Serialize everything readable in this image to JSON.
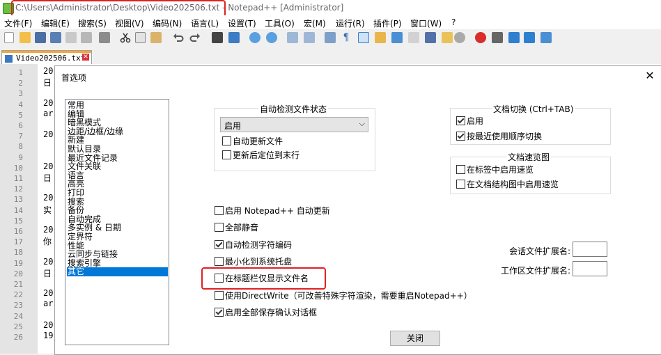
{
  "window": {
    "title": "C:\\Users\\Administrator\\Desktop\\Video202506.txt - Notepad++ [Administrator]"
  },
  "menu": [
    "文件(F)",
    "编辑(E)",
    "搜索(S)",
    "视图(V)",
    "编码(N)",
    "语言(L)",
    "设置(T)",
    "工具(O)",
    "宏(M)",
    "运行(R)",
    "插件(P)",
    "窗口(W)",
    "?"
  ],
  "tab": {
    "label": "Video202506.txt",
    "close_glyph": "✕"
  },
  "editor": {
    "line_numbers": [
      "1",
      "2",
      "3",
      "4",
      "5",
      "6",
      "7",
      "8",
      "9",
      "10",
      "11",
      "12",
      "13",
      "14",
      "15",
      "16",
      "17",
      "18",
      "19",
      "20",
      "21",
      "22",
      "23",
      "24",
      "25",
      "26"
    ],
    "code_lines": [
      {
        "line": 1,
        "text": "20"
      },
      {
        "line": 2,
        "text": "日"
      },
      {
        "line": 4,
        "text": "20"
      },
      {
        "line": 5,
        "text": "ar"
      },
      {
        "line": 7,
        "text": "20"
      },
      {
        "line": 10,
        "text": "20"
      },
      {
        "line": 11,
        "text": "日"
      },
      {
        "line": 13,
        "text": "20"
      },
      {
        "line": 14,
        "text": "实"
      },
      {
        "line": 16,
        "text": "20"
      },
      {
        "line": 17,
        "text": "你"
      },
      {
        "line": 19,
        "text": "20"
      },
      {
        "line": 20,
        "text": "日"
      },
      {
        "line": 22,
        "text": "20"
      },
      {
        "line": 23,
        "text": "ar"
      },
      {
        "line": 25,
        "text": "20"
      },
      {
        "line": 26,
        "text": "19"
      }
    ]
  },
  "dialog": {
    "title": "首选项",
    "close_glyph": "✕",
    "categories": [
      "常用",
      "编辑",
      "暗黑模式",
      "边距/边框/边缘",
      "新建",
      "默认目录",
      "最近文件记录",
      "文件关联",
      "语言",
      "高亮",
      "打印",
      "搜索",
      "备份",
      "自动完成",
      "多实例 & 日期",
      "定界符",
      "性能",
      "云同步与链接",
      "搜索引擎",
      "其它"
    ],
    "selected_category": "其它",
    "auto_detect": {
      "title": "自动检测文件状态",
      "select_value": "启用",
      "options": [
        {
          "label": "自动更新文件",
          "checked": false
        },
        {
          "label": "更新后定位到末行",
          "checked": false
        }
      ]
    },
    "doc_switch": {
      "title": "文档切换 (Ctrl+TAB)",
      "options": [
        {
          "label": "启用",
          "checked": true
        },
        {
          "label": "按最近使用顺序切换",
          "checked": true
        }
      ]
    },
    "doc_peek": {
      "title": "文档速览图",
      "options": [
        {
          "label": "在标签中启用速览",
          "checked": false
        },
        {
          "label": "在文档结构图中启用速览",
          "checked": false
        }
      ]
    },
    "misc_options": [
      {
        "label": "启用 Notepad++ 自动更新",
        "checked": false
      },
      {
        "label": "全部静音",
        "checked": false
      },
      {
        "label": "自动检测字符编码",
        "checked": true
      },
      {
        "label": "最小化到系统托盘",
        "checked": false
      },
      {
        "label": "在标题栏仅显示文件名",
        "checked": false
      },
      {
        "label": "使用DirectWrite（可改善特殊字符渲染，需要重启Notepad++）",
        "checked": false
      },
      {
        "label": "启用全部保存确认对话框",
        "checked": true
      }
    ],
    "session_ext_label": "会话文件扩展名:",
    "session_ext_value": "",
    "workspace_ext_label": "工作区文件扩展名:",
    "workspace_ext_value": "",
    "close_button": "关闭"
  }
}
